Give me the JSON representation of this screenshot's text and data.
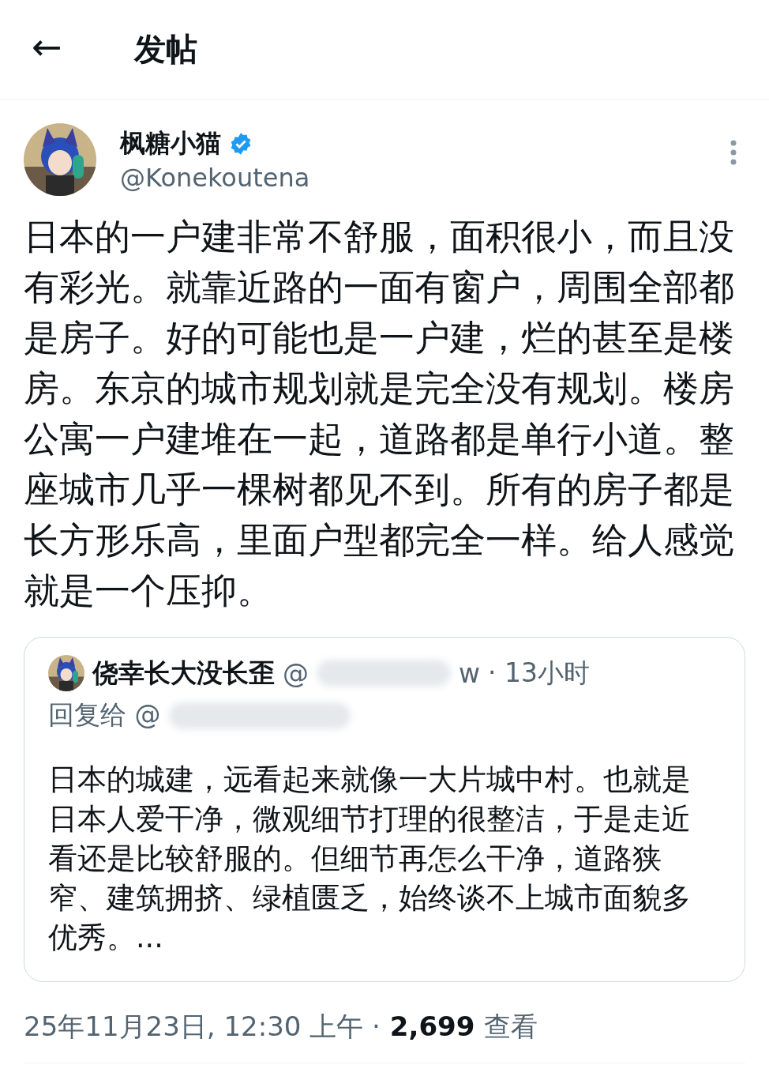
{
  "header": {
    "back": "←",
    "title": "发帖"
  },
  "post": {
    "author": {
      "name": "枫糖小猫",
      "verified": true,
      "handle": "@Konekoutena"
    },
    "text": "日本的一户建非常不舒服，面积很小，而且没有彩光。就靠近路的一面有窗户，周围全部都是房子。好的可能也是一户建，烂的甚至是楼房。东京的城市规划就是完全没有规划。楼房公寓一户建堆在一起，道路都是单行小道。整座城市几乎一棵树都见不到。所有的房子都是长方形乐高，里面户型都完全一样。给人感觉就是一个压抑。",
    "quote": {
      "name": "侥幸长大没长歪",
      "handle_start": "@",
      "handle_end": "w",
      "time": "· 13小时",
      "reply_to": "回复给 @",
      "text": "日本的城建，远看起来就像一大片城中村。也就是日本人爱干净，微观细节打理的很整洁，于是走近看还是比较舒服的。但细节再怎么干净，道路狭窄、建筑拥挤、绿植匮乏，始终谈不上城市面貌多优秀。..."
    },
    "date": "25年11月23日, 12:30 上午 ·",
    "views": "2,699",
    "views_label": "查看"
  }
}
